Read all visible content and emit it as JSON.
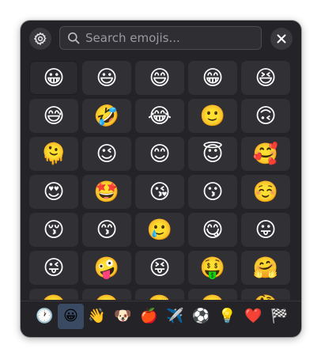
{
  "header": {
    "settings_icon": "gear-icon",
    "search_placeholder": "Search emojis...",
    "search_value": "",
    "search_icon": "search-icon",
    "close_icon": "close-icon"
  },
  "emojis": [
    "😀",
    "😃",
    "😄",
    "😁",
    "😆",
    "😅",
    "🤣",
    "😂",
    "🙂",
    "🙃",
    "🫠",
    "😉",
    "😊",
    "😇",
    "🥰",
    "😍",
    "🤩",
    "😘",
    "😗",
    "☺️",
    "😚",
    "😙",
    "🥲",
    "😋",
    "😛",
    "😜",
    "🤪",
    "😝",
    "🤑",
    "🤗",
    "🤭",
    "🫢",
    "🫣",
    "🤫",
    "🤔"
  ],
  "selected_emoji_index": 0,
  "categories": [
    {
      "name": "recent",
      "glyph": "🕐"
    },
    {
      "name": "smileys",
      "glyph": "😀"
    },
    {
      "name": "people",
      "glyph": "👋"
    },
    {
      "name": "animals",
      "glyph": "🐶"
    },
    {
      "name": "food",
      "glyph": "🍎"
    },
    {
      "name": "travel",
      "glyph": "✈️"
    },
    {
      "name": "activities",
      "glyph": "⚽"
    },
    {
      "name": "objects",
      "glyph": "💡"
    },
    {
      "name": "symbols",
      "glyph": "❤️"
    },
    {
      "name": "flags",
      "glyph": "🏁"
    }
  ],
  "active_category_index": 1,
  "colors": {
    "background": "#242428",
    "cell": "#303035",
    "active_tab": "#3a4a63"
  }
}
